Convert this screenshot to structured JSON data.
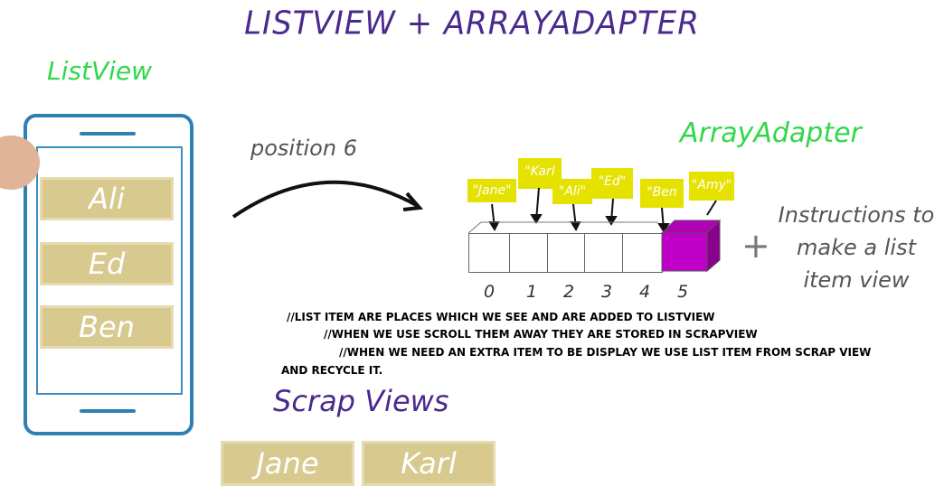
{
  "title": "LISTVIEW + ARRAYADAPTER",
  "listview": {
    "label": "ListView",
    "items": [
      "Ali",
      "Ed",
      "Ben"
    ]
  },
  "arrow_label": "position 6",
  "adapter": {
    "label": "ArrayAdapter",
    "tags": [
      "\"Jane\"",
      "\"Karl",
      "\"Ali\"",
      "\"Ed\"",
      "\"Ben",
      "\"Amy\""
    ],
    "indices": [
      "0",
      "1",
      "2",
      "3",
      "4",
      "5"
    ],
    "instructions": [
      "Instructions to",
      "make a list",
      "item view"
    ]
  },
  "notes": [
    "//LIST ITEM ARE PLACES WHICH WE SEE AND ARE ADDED TO LISTVIEW",
    "//WHEN WE USE SCROLL THEM AWAY THEY ARE STORED IN SCRAPVIEW",
    "//WHEN WE NEED AN EXTRA ITEM TO BE DISPLAY WE USE LIST ITEM FROM SCRAP VIEW",
    "AND RECYCLE IT."
  ],
  "scrap": {
    "label": "Scrap Views",
    "items": [
      "Jane",
      "Karl"
    ]
  },
  "colors": {
    "title": "#4a2a8c",
    "green_label": "#2fd84a",
    "phone": "#2f7fb3",
    "item": "#d8c98f",
    "tag": "#e6e200",
    "highlight_cell": "#c000c8"
  }
}
